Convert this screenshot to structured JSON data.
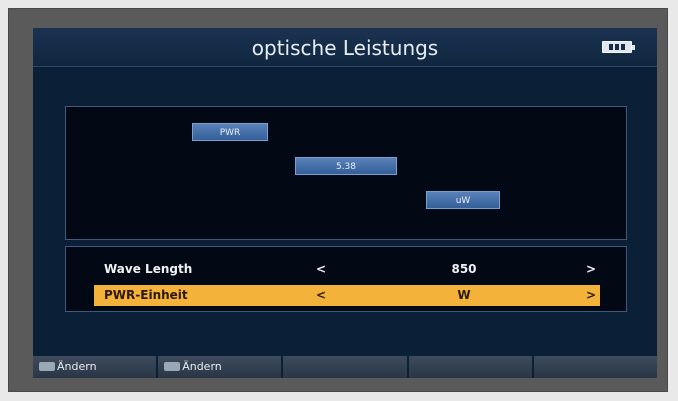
{
  "window": {
    "title": "optische Leistungs"
  },
  "status": {
    "battery_icon": "battery-icon"
  },
  "display": {
    "chips": [
      "PWR",
      "5.38",
      "uW"
    ]
  },
  "settings": {
    "rows": [
      {
        "label": "Wave Length",
        "left_arrow": "<",
        "value": "850",
        "right_arrow": ">"
      },
      {
        "label": "PWR-Einheit",
        "left_arrow": "<",
        "value": "W",
        "right_arrow": ">"
      }
    ]
  },
  "footer": {
    "buttons": [
      "Ändern",
      "Ändern",
      "",
      "",
      ""
    ]
  },
  "colors": {
    "highlight": "#f3b33b",
    "screen_bg": "#0b1f37",
    "chip": "#4a74ad"
  }
}
